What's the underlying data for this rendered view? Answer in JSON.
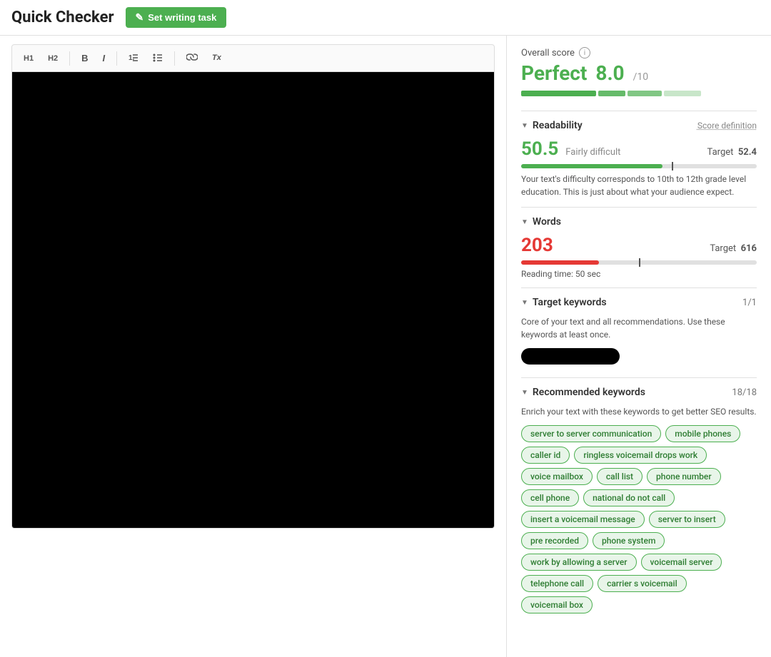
{
  "app": {
    "title": "Quick Checker",
    "set_writing_task_label": "Set writing task"
  },
  "toolbar": {
    "h1": "H1",
    "h2": "H2",
    "bold": "B",
    "italic": "I",
    "ordered_list": "ol",
    "unordered_list": "ul",
    "link": "🔗",
    "clear_format": "Tx"
  },
  "overall_score": {
    "label": "Overall score",
    "grade": "Perfect",
    "score": "8.0",
    "denom": "/10",
    "bars": [
      {
        "width": 32,
        "color": "#4caf50"
      },
      {
        "width": 12,
        "color": "#66bb6a"
      },
      {
        "width": 14,
        "color": "#81c784"
      },
      {
        "width": 14,
        "color": "#c8e6c9"
      }
    ]
  },
  "readability": {
    "section_title": "Readability",
    "score_definition_link": "Score definition",
    "score": "50.5",
    "difficulty_label": "Fairly difficult",
    "target_label": "Target",
    "target_value": "52.4",
    "progress_fill_pct": 60,
    "marker_pct": 64,
    "description": "Your text's difficulty corresponds to 10th to 12th grade level education. This is just about what your audience expect."
  },
  "words": {
    "section_title": "Words",
    "count": "203",
    "target_label": "Target",
    "target_value": "616",
    "progress_fill_pct": 33,
    "marker_pct": 50,
    "reading_time": "Reading time: 50 sec"
  },
  "target_keywords": {
    "section_title": "Target keywords",
    "count": "1/1",
    "description": "Core of your text and all recommendations. Use these keywords at least once.",
    "keyword": ""
  },
  "recommended_keywords": {
    "section_title": "Recommended keywords",
    "count": "18/18",
    "description": "Enrich your text with these keywords to get better SEO results.",
    "keywords": [
      "server to server communication",
      "mobile phones",
      "caller id",
      "ringless voicemail drops work",
      "voice mailbox",
      "call list",
      "phone number",
      "cell phone",
      "national do not call",
      "insert a voicemail message",
      "server to insert",
      "pre recorded",
      "phone system",
      "work by allowing a server",
      "voicemail server",
      "telephone call",
      "carrier s voicemail",
      "voicemail box"
    ]
  }
}
